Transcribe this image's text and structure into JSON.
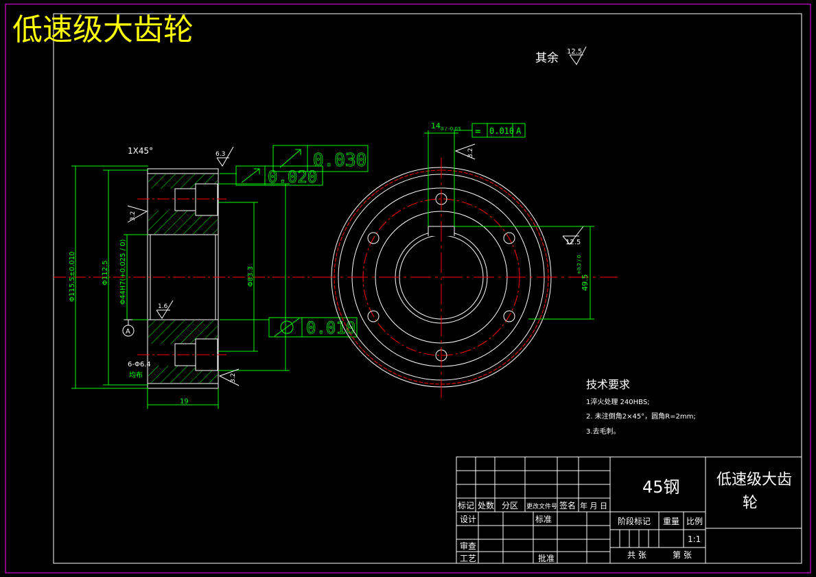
{
  "title": "低速级大齿轮",
  "surface_remainder": {
    "label": "其余",
    "value": "12.5"
  },
  "left_view": {
    "chamfer": "1X45°",
    "roughness_top": "6.3",
    "roughness_left": "3.2",
    "roughness_bore": "1.6",
    "roughness_bottom": "3.2",
    "runout_1": "0.030",
    "runout_2": "0.020",
    "flatness": "0.010",
    "dim_outer": "Φ115.5±0.010",
    "dim_mid": "Φ112.5",
    "dim_bore": "Φ44H7(+0.025 / 0)",
    "dim_hub": "Φ83.3",
    "width": "19",
    "datum": "A",
    "holes": "6-Φ6.4",
    "holes_note": "均布"
  },
  "right_view": {
    "keyway_width": "14",
    "keyway_tol": "0 / -0.03",
    "symmetry_symbol": "=",
    "symmetry_value": "0.010",
    "symmetry_datum": "A",
    "roughness_key": "3.2",
    "roughness_side": "12.5",
    "key_depth": "49.5",
    "key_depth_tol": "+0.2 / 0"
  },
  "tech_req": {
    "heading": "技术要求",
    "lines": [
      "1淬火处理 240HBS;",
      "2. 未注倒角2×45°，圆角R=2mm;",
      "3.去毛刺。"
    ]
  },
  "title_block": {
    "material": "45钢",
    "part_name_line1": "低速级大齿",
    "part_name_line2": "轮",
    "headers": [
      "标记",
      "处数",
      "分区",
      "更改文件号",
      "签名",
      "年 月 日"
    ],
    "design": "设计",
    "standard": "标准",
    "check": "审查",
    "process": "工艺",
    "approve": "批准",
    "stage": "阶段标记",
    "weight": "重量",
    "scale_label": "比例",
    "scale": "1:1",
    "total": "共  张",
    "sheet": "第  张"
  },
  "colors": {
    "line": "#ffffff",
    "dim": "#00ff00",
    "center": "#ff0000",
    "hatch": "#00ff00",
    "title": "#ffff00",
    "border": "#ff00ff"
  }
}
